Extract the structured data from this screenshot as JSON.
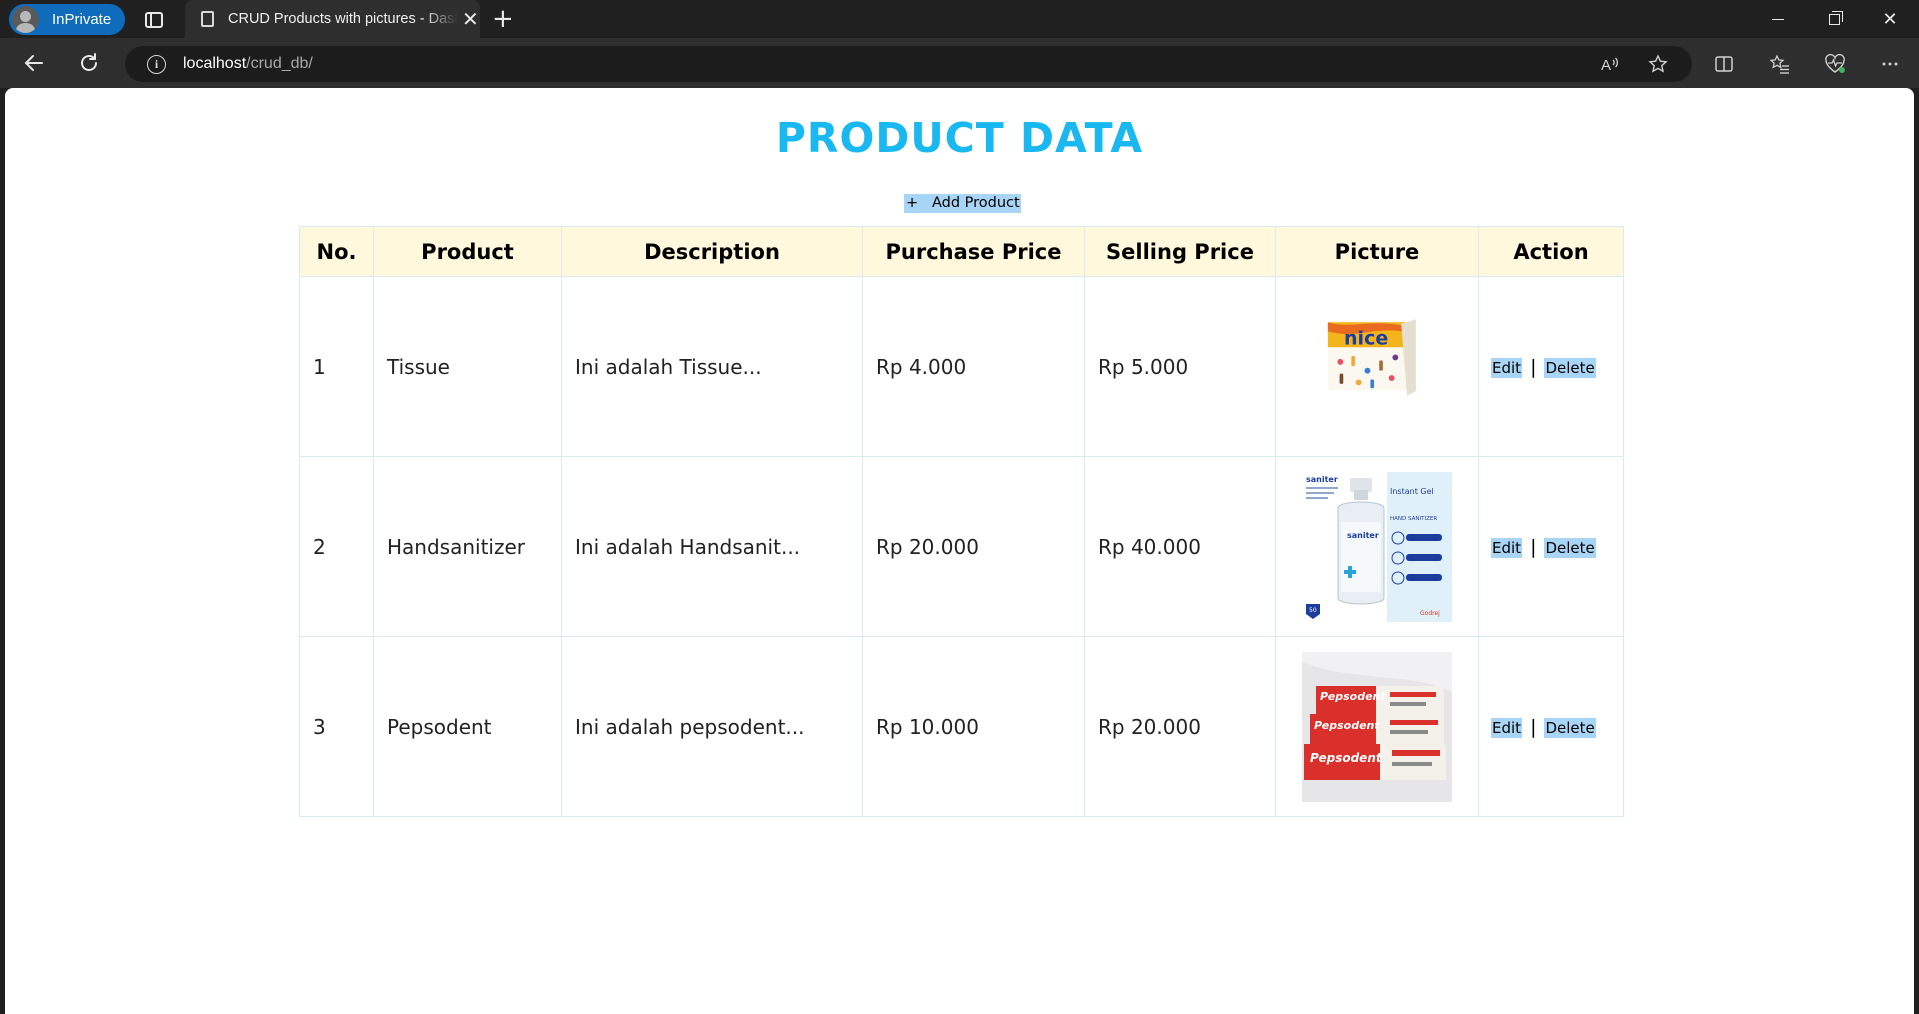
{
  "browser": {
    "inprivate_label": "InPrivate",
    "tab_title": "CRUD Products with pictures - Dashboard",
    "url_host": "localhost",
    "url_path": "/crud_db/"
  },
  "page": {
    "title": "PRODUCT DATA",
    "add_button": "+   Add Product",
    "title_color": "#19b8f0"
  },
  "table": {
    "headers": [
      "No.",
      "Product",
      "Description",
      "Purchase Price",
      "Selling Price",
      "Picture",
      "Action"
    ],
    "rows": [
      {
        "no": "1",
        "product": "Tissue",
        "description": "Ini adalah Tissue...",
        "purchase": "Rp 4.000",
        "selling": "Rp 5.000",
        "picture": "tissue-box-image",
        "edit": "Edit",
        "delete": "Delete"
      },
      {
        "no": "2",
        "product": "Handsanitizer",
        "description": "Ini adalah Handsanit...",
        "purchase": "Rp 20.000",
        "selling": "Rp 40.000",
        "picture": "hand-sanitizer-image",
        "edit": "Edit",
        "delete": "Delete"
      },
      {
        "no": "3",
        "product": "Pepsodent",
        "description": "Ini adalah pepsodent...",
        "purchase": "Rp 10.000",
        "selling": "Rp 20.000",
        "picture": "pepsodent-toothpaste-image",
        "edit": "Edit",
        "delete": "Delete"
      }
    ],
    "separator": "|"
  },
  "product_image_text": {
    "tissue_brand": "nice",
    "sanitizer_brand": "saniter",
    "sanitizer_tag": "Instant Gel",
    "sanitizer_type": "HAND SANITIZER",
    "pepsodent_brand": "Pepsodent"
  }
}
